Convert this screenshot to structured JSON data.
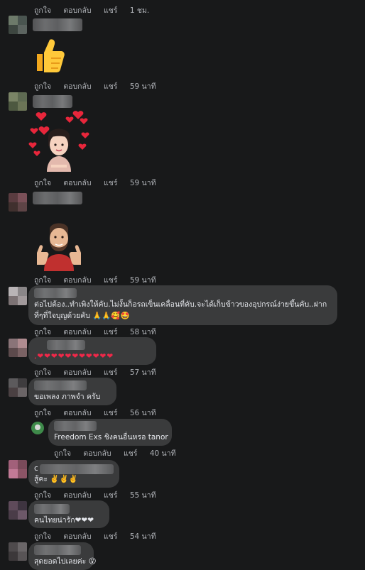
{
  "actions": {
    "like": "ถูกใจ",
    "reply": "ตอบกลับ",
    "share": "แชร์"
  },
  "comments": [
    {
      "time": "1 ชม."
    },
    {
      "time": "59 นาที",
      "sticker": "thumbs-up-icon"
    },
    {
      "time": "59 นาที",
      "sticker": "woman-hearts-sticker"
    },
    {
      "time": "59 นาที",
      "sticker": "man-thumbs-up-sticker"
    },
    {
      "time": "58 นาที",
      "line1": "ต่อไปต้อง..ทำเพิงให้คับ.ไม่งั้นก็อรถเข็นเคลื่อนที่คับ.จะได้เก็บข้าวของอุปกรณ์ง่ายขึ้นคับ..ฝาก",
      "line2": "ที่ๆที่ใจบุญด้วยคับ 🙏🙏🥰🤩"
    },
    {
      "time": "57 นาที",
      "line1": ",❤❤❤❤❤❤❤❤❤❤❤"
    },
    {
      "time": "56 นาที",
      "line1": "ขอเพลง ภาพจำ ครับ"
    },
    {
      "time": "40 นาที",
      "line1": "Freedom Exs ชิงคนอื่นหรอ tanor"
    },
    {
      "time": "55 นาที",
      "line0": "c",
      "line1": "สู้คะ ✌️✌️✌️"
    },
    {
      "time": "54 นาที",
      "line1": "คนไทยน่ารัก❤❤❤"
    },
    {
      "line1": "สุดยอดไปเลยค่ะ 😮"
    }
  ]
}
